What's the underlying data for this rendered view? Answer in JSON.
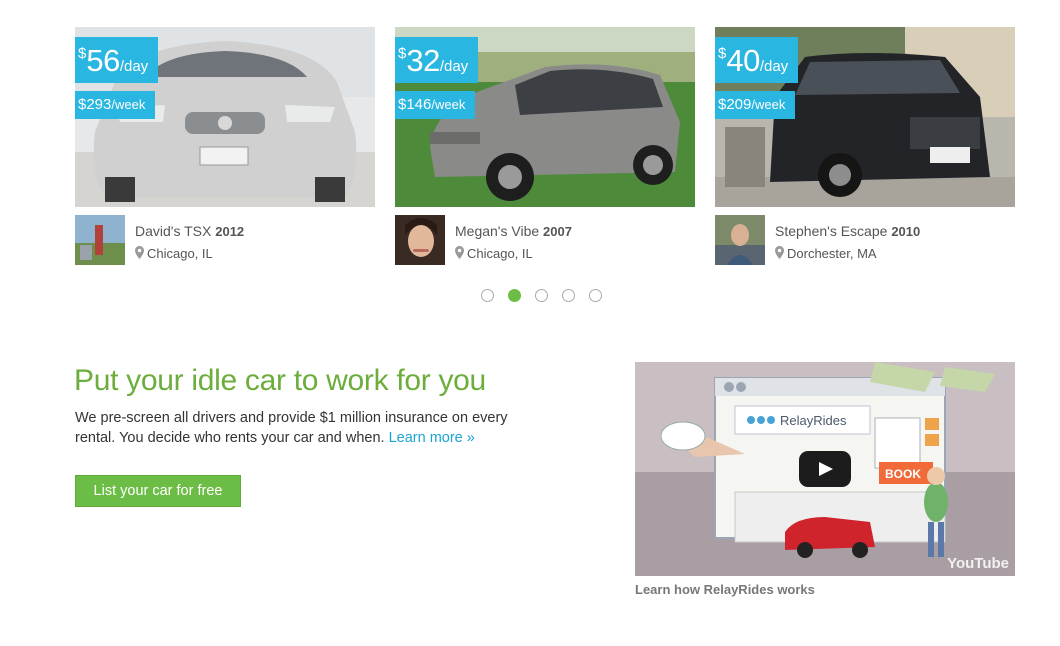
{
  "listings": [
    {
      "price_currency": "$",
      "price_day": "56",
      "price_day_unit": "/day",
      "price_week": "$293",
      "price_week_unit": "/week",
      "owner_name": "David's TSX",
      "year": "2012",
      "location": "Chicago, IL",
      "car_color": "#c9c9c7"
    },
    {
      "price_currency": "$",
      "price_day": "32",
      "price_day_unit": "/day",
      "price_week": "$146",
      "price_week_unit": "/week",
      "owner_name": "Megan's Vibe",
      "year": "2007",
      "location": "Chicago, IL",
      "car_color": "#8a8a88"
    },
    {
      "price_currency": "$",
      "price_day": "40",
      "price_day_unit": "/day",
      "price_week": "$209",
      "price_week_unit": "/week",
      "owner_name": "Stephen's Escape",
      "year": "2010",
      "location": "Dorchester, MA",
      "car_color": "#222428"
    }
  ],
  "carousel": {
    "page_count": 5,
    "active_index": 1
  },
  "promo": {
    "headline": "Put your idle car to work for you",
    "body": "We pre-screen all drivers and provide $1 million insurance on every rental. You decide who rents your car and when.",
    "learn_more": "Learn more  »",
    "cta": "List your car for free"
  },
  "video": {
    "brand": "RelayRides",
    "button_label": "BOOK",
    "youtube_mark": "YouTube",
    "caption": "Learn how RelayRides works"
  },
  "colors": {
    "accent_blue": "#29b6e0",
    "accent_green": "#6cbd45",
    "headline_green": "#6cad3b",
    "link_blue": "#1ba3d4"
  }
}
